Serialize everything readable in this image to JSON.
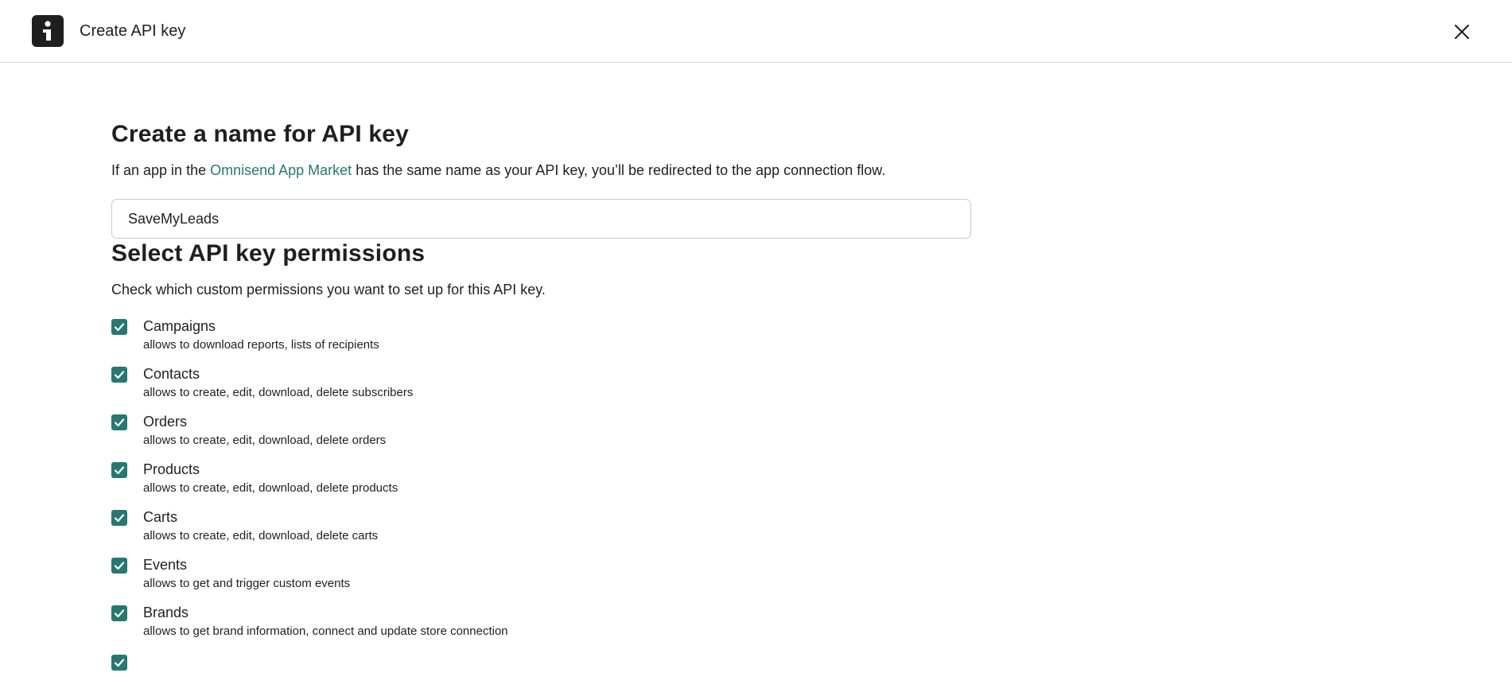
{
  "header": {
    "title": "Create API key",
    "logo_icon": "omnisend-logo",
    "close_icon": "close-icon"
  },
  "name_section": {
    "title": "Create a name for API key",
    "desc_before": "If an app in the ",
    "desc_link": "Omnisend App Market",
    "desc_after": " has the same name as your API key, you’ll be redirected to the app connection flow.",
    "input_value": "SaveMyLeads"
  },
  "permissions_section": {
    "title": "Select API key permissions",
    "desc": "Check which custom permissions you want to set up for this API key.",
    "items": [
      {
        "label": "Campaigns",
        "sub": "allows to download reports, lists of recipients",
        "checked": true
      },
      {
        "label": "Contacts",
        "sub": "allows to create, edit, download, delete subscribers",
        "checked": true
      },
      {
        "label": "Orders",
        "sub": "allows to create, edit, download, delete orders",
        "checked": true
      },
      {
        "label": "Products",
        "sub": "allows to create, edit, download, delete products",
        "checked": true
      },
      {
        "label": "Carts",
        "sub": "allows to create, edit, download, delete carts",
        "checked": true
      },
      {
        "label": "Events",
        "sub": "allows to get and trigger custom events",
        "checked": true
      },
      {
        "label": "Brands",
        "sub": "allows to get brand information, connect and update store connection",
        "checked": true
      },
      {
        "label": "",
        "sub": "",
        "checked": true
      }
    ]
  },
  "colors": {
    "accent": "#28786f",
    "text": "#1f1f1f",
    "border": "#d9d9d9"
  }
}
